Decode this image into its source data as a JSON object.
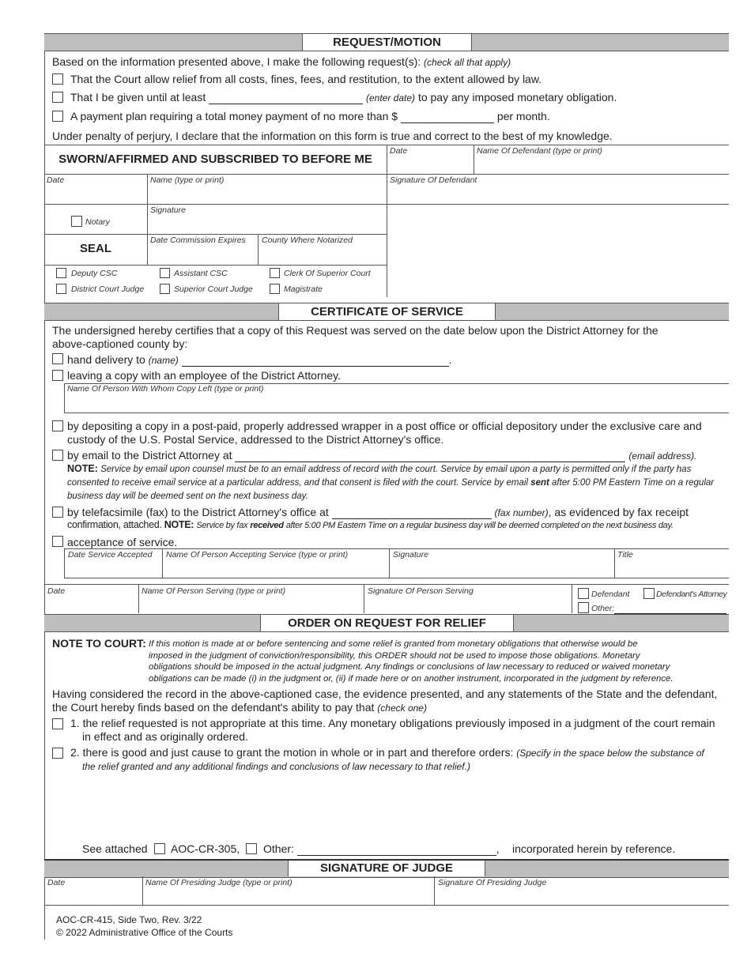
{
  "request_motion": {
    "title": "REQUEST/MOTION",
    "intro": "Based on the information presented above, I make the following request(s):",
    "intro_hint": "(check all that apply)",
    "options": [
      {
        "text": "That the Court allow relief from all costs, fines, fees, and restitution, to the extent allowed by law."
      },
      {
        "text_before": "That I be given until at least",
        "hint": "(enter date)",
        "text_after": "to pay any imposed monetary obligation."
      },
      {
        "text_before": "A payment plan requiring a total money payment of no more than $",
        "text_after": "per month."
      }
    ],
    "perjury": "Under penalty of perjury, I declare that the information on this form is true and correct to the best of my knowledge."
  },
  "sworn": {
    "title": "SWORN/AFFIRMED AND SUBSCRIBED TO BEFORE ME",
    "date_label": "Date",
    "name_label": "Name (type or print)",
    "signature_label": "Signature",
    "notary_label": "Notary",
    "seal_label": "SEAL",
    "commission_label": "Date Commission Expires",
    "county_label": "County Where Notarized",
    "roles": [
      "Deputy CSC",
      "Assistant CSC",
      "Clerk Of Superior Court",
      "District Court Judge",
      "Superior Court Judge",
      "Magistrate"
    ]
  },
  "defendant": {
    "date_label": "Date",
    "name_label": "Name Of Defendant (type or print)",
    "signature_label": "Signature Of Defendant"
  },
  "certificate": {
    "title": "CERTIFICATE OF SERVICE",
    "intro": "The undersigned hereby certifies that a copy of this Request was served on the date below upon the District Attorney for the above-captioned county by:",
    "hand_delivery": "hand delivery to",
    "hand_delivery_hint": "(name)",
    "leaving_copy": "leaving a copy with an employee of the District Attorney.",
    "copy_left_label": "Name Of Person With Whom Copy Left (type or print)",
    "depositing": "by depositing a copy in a post-paid, properly addressed wrapper in a post office or official depository under the exclusive care and custody of the U.S. Postal Service, addressed to the District Attorney's office.",
    "email": "by email to the District Attorney at",
    "email_hint": "(email address).",
    "email_note_label": "NOTE:",
    "email_note_1": "Service by email upon counsel must be to an email address of record with the court. Service by email upon a party is permitted only if the party has consented to receive email service at a particular address, and that consent is filed with the court. Service by email",
    "email_note_bold": "sent",
    "email_note_2": "after 5:00 PM Eastern Time on a regular business day will be deemed sent on the next business day.",
    "fax": "by telefacsimile (fax) to the District Attorney's office at",
    "fax_hint": "(fax number)",
    "fax_after": ", as evidenced by fax receipt",
    "fax_line2": "confirmation, attached.",
    "fax_note_label": "NOTE:",
    "fax_note_1": "Service by fax",
    "fax_note_bold": "received",
    "fax_note_2": "after 5:00 PM Eastern Time on a regular business day will be deemed completed on the next business day.",
    "acceptance": "acceptance of service.",
    "accept_date_label": "Date Service Accepted",
    "accept_name_label": "Name Of Person Accepting Service (type or print)",
    "accept_sig_label": "Signature",
    "accept_title_label": "Title",
    "serving_date_label": "Date",
    "serving_name_label": "Name Of Person Serving (type or print)",
    "serving_sig_label": "Signature Of Person Serving",
    "serving_roles": [
      "Defendant",
      "Defendant's Attorney",
      "Other:"
    ]
  },
  "order": {
    "title": "ORDER ON REQUEST FOR RELIEF",
    "note_label": "NOTE TO COURT:",
    "note_lines": [
      "If this motion is made at or before sentencing and some relief is granted from monetary obligations that otherwise would be",
      "imposed in the judgment of conviction/responsibility, this ORDER should not be used to impose those obligations. Monetary",
      "obligations should be imposed in the actual judgment. Any findings or conclusions of law necessary to reduced or waived monetary",
      "obligations can be made (i) in the judgment or, (ii) if made here or on another instrument, incorporated in the judgment by reference."
    ],
    "having_line1": "Having considered the record in the above-captioned case, the evidence presented, and any statements of the State and the defendant,",
    "having_line2": "the Court hereby finds based on the defendant's ability to pay that",
    "having_hint": "(check one)",
    "option1_line1": "1. the relief requested is not appropriate at this time. Any monetary obligations previously imposed in a judgment of the court remain",
    "option1_line2": "in effect and as originally ordered.",
    "option2_line1": "2. there is good and just cause to grant the motion in whole or in part and therefore orders:",
    "option2_hint1": "(Specify in the space below the substance of",
    "option2_hint2": "the relief granted and any additional findings and conclusions of law necessary to that relief.)",
    "see_attached": "See attached",
    "aoc_option": "AOC-CR-305,",
    "other_option": "Other:",
    "incorporated": "incorporated herein by reference."
  },
  "judge": {
    "title": "SIGNATURE OF JUDGE",
    "date_label": "Date",
    "name_label": "Name Of Presiding Judge (type or print)",
    "signature_label": "Signature Of Presiding Judge"
  },
  "footer": {
    "form_id": "AOC-CR-415, Side Two, Rev. 3/22",
    "copyright": "© 2022 Administrative Office of the Courts"
  }
}
